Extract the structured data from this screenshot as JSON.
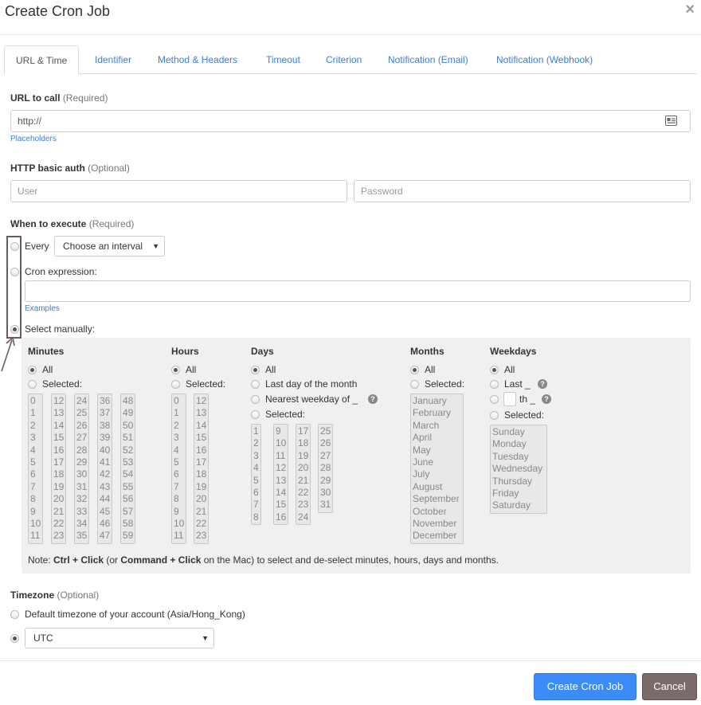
{
  "header": {
    "title": "Create Cron Job",
    "close": "×"
  },
  "tabs": [
    {
      "label": "URL & Time"
    },
    {
      "label": "Identifier"
    },
    {
      "label": "Method & Headers"
    },
    {
      "label": "Timeout"
    },
    {
      "label": "Criterion"
    },
    {
      "label": "Notification (Email)"
    },
    {
      "label": "Notification (Webhook)"
    }
  ],
  "url": {
    "label": "URL to call",
    "hint": "(Required)",
    "value": "http://",
    "placeholders_link": "Placeholders"
  },
  "auth": {
    "label": "HTTP basic auth",
    "hint": "(Optional)",
    "user_placeholder": "User",
    "password_placeholder": "Password"
  },
  "when": {
    "label": "When to execute",
    "hint": "(Required)",
    "every": "Every",
    "interval_select": "Choose an interval",
    "cron_expr": "Cron expression:",
    "examples_link": "Examples",
    "manual": "Select manually:",
    "selected_mode": "manual"
  },
  "manual": {
    "minutes": {
      "head": "Minutes",
      "all": "All",
      "selected": "Selected:"
    },
    "hours": {
      "head": "Hours",
      "all": "All",
      "selected": "Selected:"
    },
    "days": {
      "head": "Days",
      "all": "All",
      "last_day": "Last day of the month",
      "nearest": "Nearest weekday of _",
      "selected": "Selected:"
    },
    "months": {
      "head": "Months",
      "all": "All",
      "selected": "Selected:",
      "list": [
        "January",
        "February",
        "March",
        "April",
        "May",
        "June",
        "July",
        "August",
        "September",
        "October",
        "November",
        "December"
      ]
    },
    "weekdays": {
      "head": "Weekdays",
      "all": "All",
      "last": "Last _",
      "nth": "th _",
      "selected": "Selected:",
      "list": [
        "Sunday",
        "Monday",
        "Tuesday",
        "Wednesday",
        "Thursday",
        "Friday",
        "Saturday"
      ]
    },
    "note": {
      "p1": "Note: ",
      "b1": "Ctrl + Click",
      "p2": " (or ",
      "b2": "Command + Click",
      "p3": " on the Mac) to select and de-select minutes, hours, days and months."
    }
  },
  "timezone": {
    "label": "Timezone",
    "hint": "(Optional)",
    "default": "Default timezone of your account (Asia/Hong_Kong)",
    "select": "UTC"
  },
  "footer": {
    "create": "Create Cron Job",
    "cancel": "Cancel"
  },
  "colors": {
    "accent": "#3b8cf7",
    "link": "#3b7ddd",
    "cancel": "#7b6b6b",
    "panel": "#f0f0f0"
  },
  "icons": {
    "close": "close-icon",
    "address_card": "address-card-icon",
    "help": "question-icon",
    "arrow": "annotation-arrow"
  }
}
